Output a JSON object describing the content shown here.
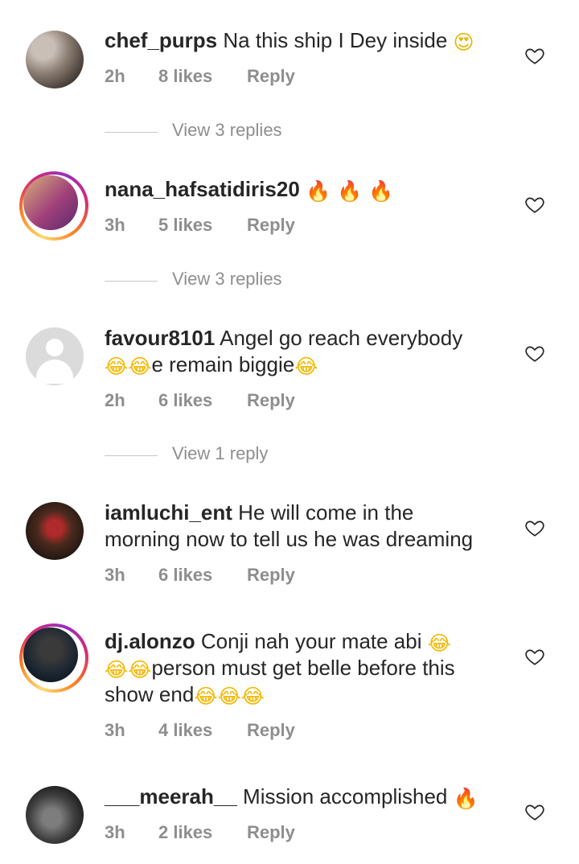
{
  "comments": [
    {
      "username": "chef_purps",
      "text": "Na this ship I Dey inside",
      "emoji": "😍",
      "time": "2h",
      "likes": "8 likes",
      "reply": "Reply",
      "view_replies": "View 3 replies"
    },
    {
      "username": "nana_hafsatidiris20",
      "text": "",
      "emoji": "🔥 🔥 🔥",
      "time": "3h",
      "likes": "5 likes",
      "reply": "Reply",
      "view_replies": "View 3 replies"
    },
    {
      "username": "favour8101",
      "text_line1": "Angel go reach everybody",
      "emoji_a": "😂😂",
      "text_line2": "e remain biggie",
      "emoji_b": "😂",
      "time": "2h",
      "likes": "6 likes",
      "reply": "Reply",
      "view_replies": "View 1 reply"
    },
    {
      "username": "iamluchi_ent",
      "text_line1": "He will come in the",
      "text_line2": "morning now to tell us he was dreaming",
      "time": "3h",
      "likes": "6 likes",
      "reply": "Reply"
    },
    {
      "username": "dj.alonzo",
      "text_line1": "Conji nah your mate abi",
      "emoji_a": "😂",
      "emoji_b": "😂😂",
      "text_line2": "person must get belle before this",
      "text_line3": "show end",
      "emoji_c": "😂😂😂",
      "time": "3h",
      "likes": "4 likes",
      "reply": "Reply"
    },
    {
      "username": "___meerah__",
      "text": "Mission accomplished",
      "emoji": "🔥",
      "time": "3h",
      "likes": "2 likes",
      "reply": "Reply"
    }
  ],
  "icons": {
    "like": "heart-outline-icon"
  },
  "colors": {
    "text": "#262626",
    "muted": "#8e8e8e",
    "divider": "#c7c7c7"
  }
}
